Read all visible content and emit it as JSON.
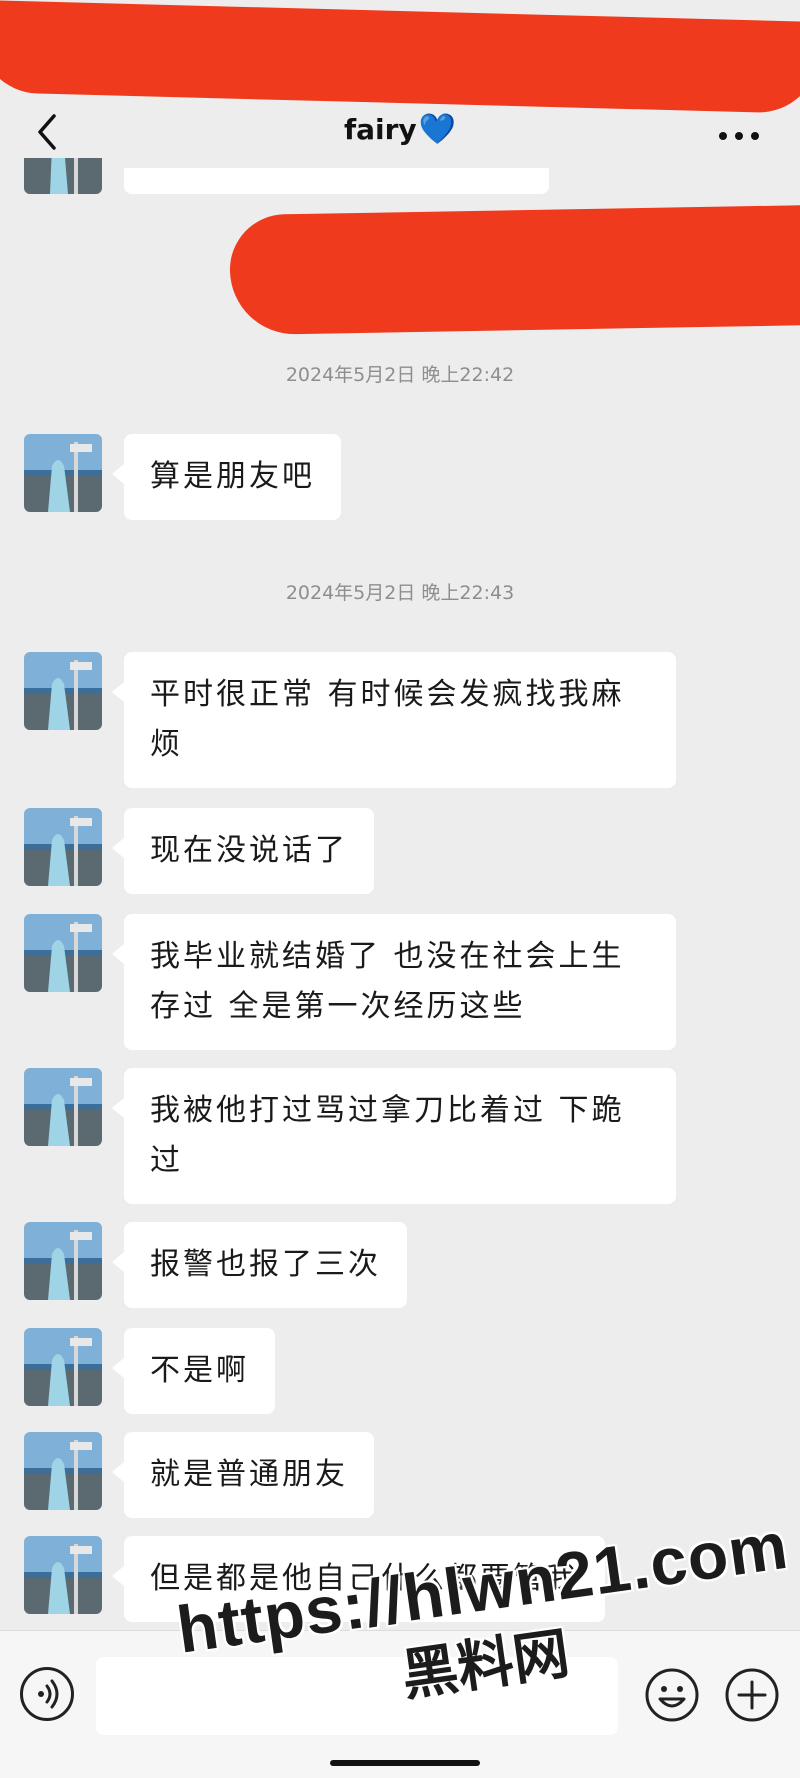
{
  "header": {
    "title": "fairy",
    "title_emoji": "💙"
  },
  "messages": {
    "timestamp_1": "2024年5月2日 晚上22:42",
    "timestamp_2": "2024年5月2日 晚上22:43",
    "items": [
      {
        "text": "算是朋友吧"
      },
      {
        "text": "平时很正常 有时候会发疯找我麻烦"
      },
      {
        "text": "现在没说话了"
      },
      {
        "text": "我毕业就结婚了 也没在社会上生存过 全是第一次经历这些"
      },
      {
        "text": "我被他打过骂过拿刀比着过 下跪过"
      },
      {
        "text": "报警也报了三次"
      },
      {
        "text": "不是啊"
      },
      {
        "text": "就是普通朋友"
      },
      {
        "text": "但是都是他自己什么都要管我"
      }
    ]
  },
  "watermark": {
    "url": "https://hlwn21.com",
    "name": "黑料网"
  },
  "colors": {
    "background": "#ededed",
    "bubble": "#ffffff",
    "redaction": "#ef3a1e",
    "heart": "#2f8ce0"
  },
  "icons": [
    "back-icon",
    "more-icon",
    "voice-icon",
    "emoji-icon",
    "plus-icon"
  ]
}
